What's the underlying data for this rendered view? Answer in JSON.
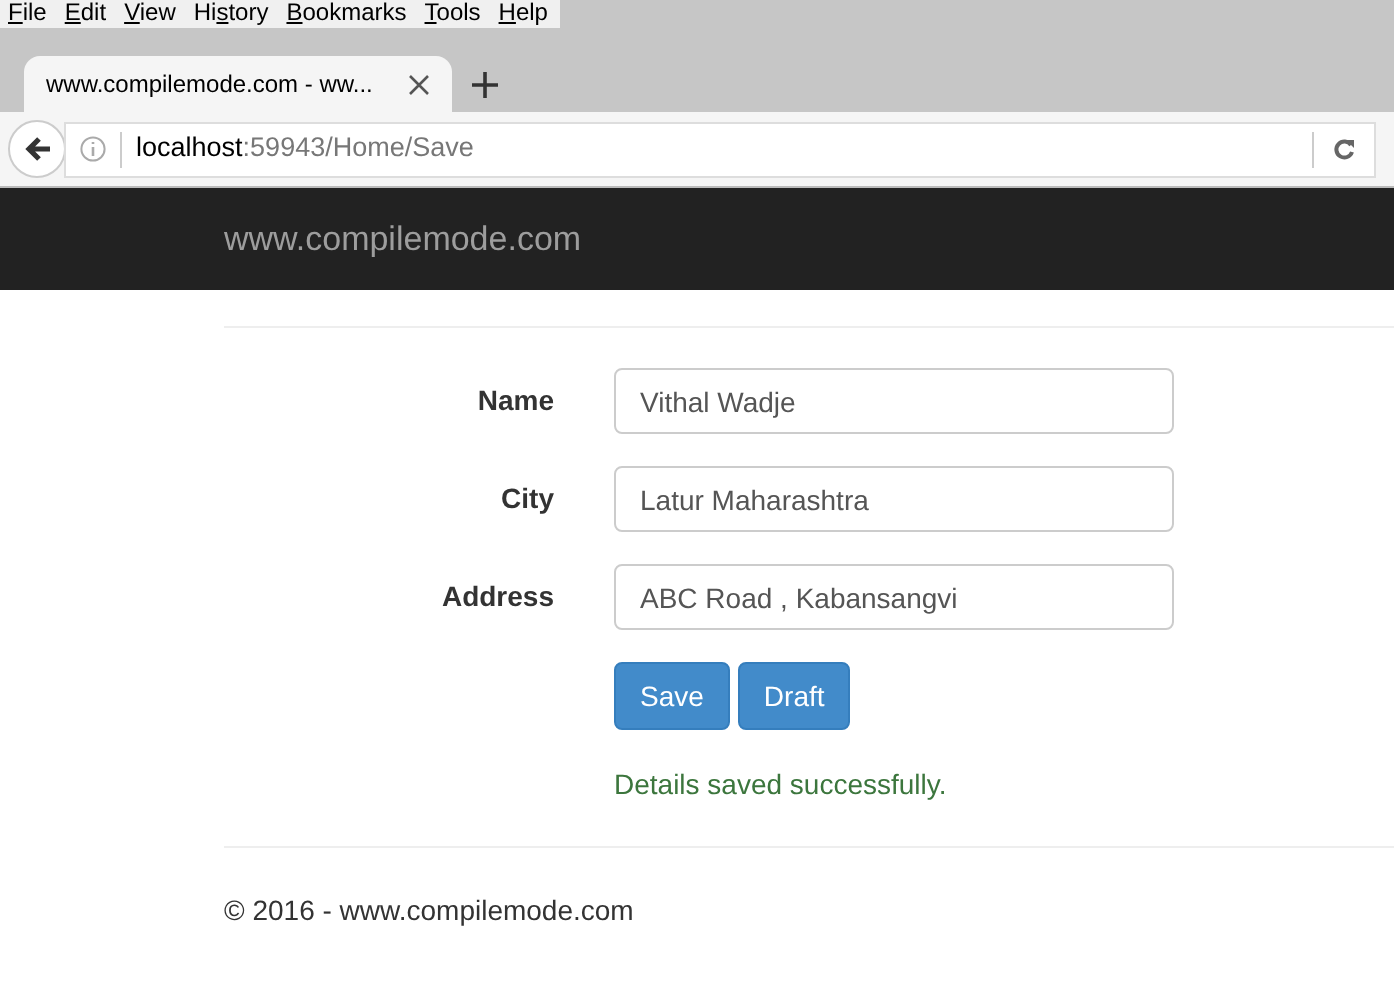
{
  "menu": [
    {
      "label": "File"
    },
    {
      "label": "Edit"
    },
    {
      "label": "View"
    },
    {
      "label": "History"
    },
    {
      "label": "Bookmarks"
    },
    {
      "label": "Tools"
    },
    {
      "label": "Help"
    }
  ],
  "tab": {
    "title": "www.compilemode.com - ww...",
    "selected": true
  },
  "address": {
    "host": "localhost",
    "path": ":59943/Home/Save"
  },
  "brand": "www.compilemode.com",
  "fields": [
    {
      "label": "Name",
      "value": "Vithal Wadje"
    },
    {
      "label": "City",
      "value": "Latur Maharashtra"
    },
    {
      "label": "Address",
      "value": "ABC Road , Kabansangvi"
    }
  ],
  "buttons": [
    "Save",
    "Draft"
  ],
  "message": "Details saved successfully.",
  "footer": "© 2016 - www.compilemode.com"
}
